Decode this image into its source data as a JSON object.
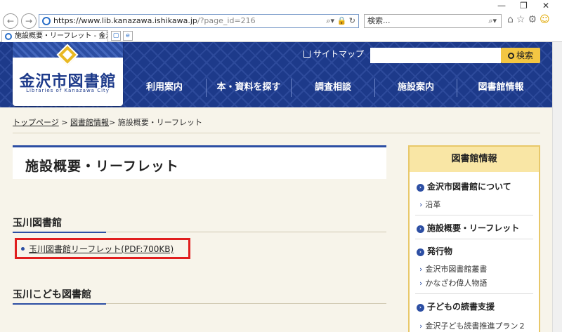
{
  "browser": {
    "url_main": "https://www.lib.kanazawa.ishikawa.jp",
    "url_path": "/?page_id=216",
    "search_placeholder": "検索...",
    "tab_title": "施設概要・リーフレット - 金沢..."
  },
  "header": {
    "logo_title": "金沢市図書館",
    "logo_subtitle": "Libraries of Kanazawa City",
    "sitemap_label": "サイトマップ",
    "search_button_label": "検索",
    "nav": [
      {
        "label": "利用案内"
      },
      {
        "label": "本・資料を探す"
      },
      {
        "label": "調査相談"
      },
      {
        "label": "施設案内"
      },
      {
        "label": "図書館情報"
      }
    ]
  },
  "breadcrumb": {
    "home": "トップページ",
    "parent": "図書館情報",
    "sep": ">",
    "current": "施設概要・リーフレット"
  },
  "main": {
    "page_title": "施設概要・リーフレット",
    "sections": [
      {
        "heading": "玉川図書館",
        "link": "玉川図書館リーフレット(PDF:700KB)"
      },
      {
        "heading": "玉川こども図書館"
      }
    ]
  },
  "sidebar": {
    "title": "図書館情報",
    "groups": [
      {
        "label": "金沢市図書館について",
        "children": [
          "沿革"
        ]
      },
      {
        "label": "施設概要・リーフレット",
        "children": []
      },
      {
        "label": "発行物",
        "children": [
          "金沢市図書館叢書",
          "かなざわ偉人物語"
        ]
      },
      {
        "label": "子どもの読書支援",
        "children": [
          "金沢子ども読書推進プラン２"
        ]
      }
    ]
  },
  "colors": {
    "header_blue": "#1d3a8a",
    "accent_yellow": "#f3c643",
    "highlight_red": "#e01e1e"
  }
}
